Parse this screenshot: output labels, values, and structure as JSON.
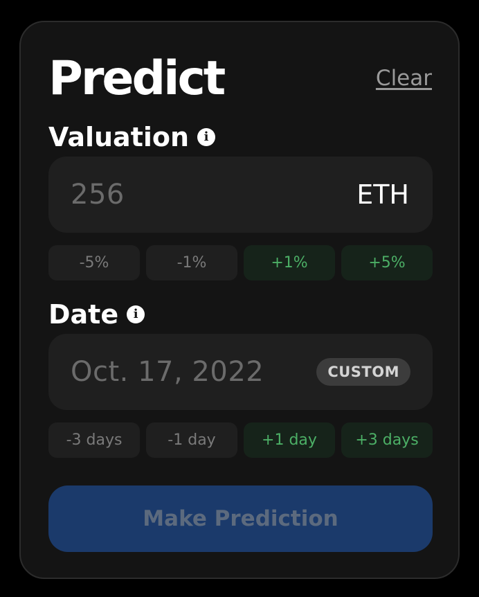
{
  "header": {
    "title": "Predict",
    "clear_label": "Clear"
  },
  "valuation": {
    "label": "Valuation",
    "info_icon": "info-icon",
    "value": "256",
    "unit": "ETH",
    "adjustments": [
      "-5%",
      "-1%",
      "+1%",
      "+5%"
    ]
  },
  "date": {
    "label": "Date",
    "info_icon": "info-icon",
    "value": "Oct. 17, 2022",
    "badge": "CUSTOM",
    "adjustments": [
      "-3 days",
      "-1 day",
      "+1 day",
      "+3 days"
    ]
  },
  "submit": {
    "label": "Make Prediction"
  },
  "colors": {
    "background": "#000000",
    "card": "#141414",
    "field": "#1f1f1f",
    "positive_chip_bg": "#16231a",
    "positive_text": "#4caf66",
    "negative_text": "#7a7a7a",
    "button_bg": "#1b3a6b",
    "button_text": "#5c6a7e"
  }
}
